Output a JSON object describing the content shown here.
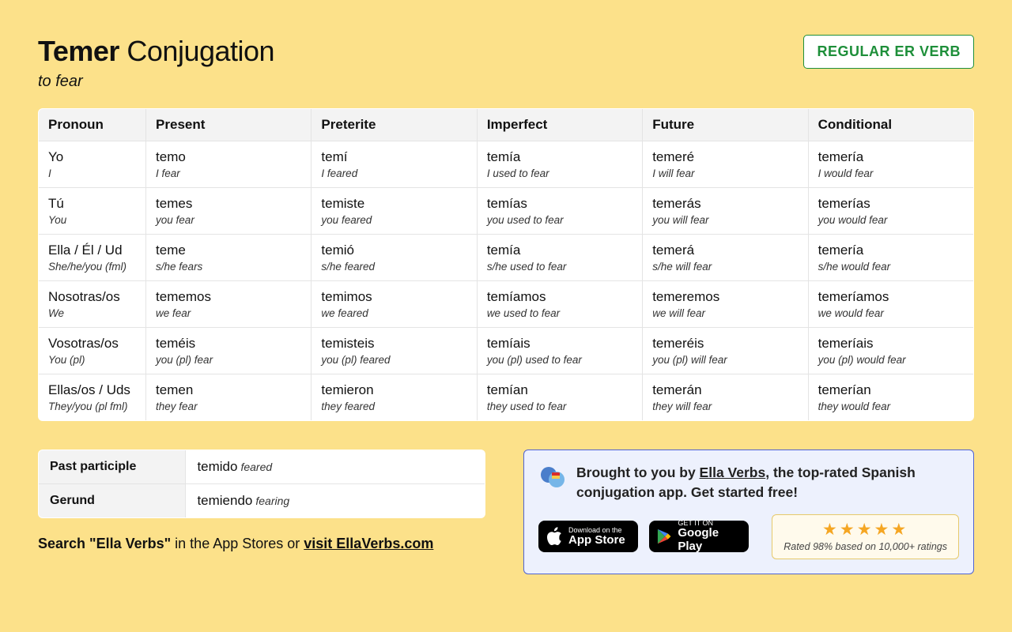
{
  "title_bold": "Temer",
  "title_rest": "Conjugation",
  "subtitle": "to fear",
  "badge": "REGULAR ER VERB",
  "headers": [
    "Pronoun",
    "Present",
    "Preterite",
    "Imperfect",
    "Future",
    "Conditional"
  ],
  "pronouns": [
    {
      "es": "Yo",
      "en": "I"
    },
    {
      "es": "Tú",
      "en": "You"
    },
    {
      "es": "Ella / Él / Ud",
      "en": "She/he/you (fml)"
    },
    {
      "es": "Nosotras/os",
      "en": "We"
    },
    {
      "es": "Vosotras/os",
      "en": "You (pl)"
    },
    {
      "es": "Ellas/os / Uds",
      "en": "They/you (pl fml)"
    }
  ],
  "table": [
    [
      {
        "es": "temo",
        "en": "I fear"
      },
      {
        "es": "temí",
        "en": "I feared"
      },
      {
        "es": "temía",
        "en": "I used to fear"
      },
      {
        "es": "temeré",
        "en": "I will fear"
      },
      {
        "es": "temería",
        "en": "I would fear"
      }
    ],
    [
      {
        "es": "temes",
        "en": "you fear"
      },
      {
        "es": "temiste",
        "en": "you feared"
      },
      {
        "es": "temías",
        "en": "you used to fear"
      },
      {
        "es": "temerás",
        "en": "you will fear"
      },
      {
        "es": "temerías",
        "en": "you would fear"
      }
    ],
    [
      {
        "es": "teme",
        "en": "s/he fears"
      },
      {
        "es": "temió",
        "en": "s/he feared"
      },
      {
        "es": "temía",
        "en": "s/he used to fear"
      },
      {
        "es": "temerá",
        "en": "s/he will fear"
      },
      {
        "es": "temería",
        "en": "s/he would fear"
      }
    ],
    [
      {
        "es": "tememos",
        "en": "we fear"
      },
      {
        "es": "temimos",
        "en": "we feared"
      },
      {
        "es": "temíamos",
        "en": "we used to fear"
      },
      {
        "es": "temeremos",
        "en": "we will fear"
      },
      {
        "es": "temeríamos",
        "en": "we would fear"
      }
    ],
    [
      {
        "es": "teméis",
        "en": "you (pl) fear"
      },
      {
        "es": "temisteis",
        "en": "you (pl) feared"
      },
      {
        "es": "temíais",
        "en": "you (pl) used to fear"
      },
      {
        "es": "temeréis",
        "en": "you (pl) will fear"
      },
      {
        "es": "temeríais",
        "en": "you (pl) would fear"
      }
    ],
    [
      {
        "es": "temen",
        "en": "they fear"
      },
      {
        "es": "temieron",
        "en": "they feared"
      },
      {
        "es": "temían",
        "en": "they used to fear"
      },
      {
        "es": "temerán",
        "en": "they will fear"
      },
      {
        "es": "temerían",
        "en": "they would fear"
      }
    ]
  ],
  "forms": {
    "past_participle_label": "Past participle",
    "past_participle_es": "temido",
    "past_participle_en": "feared",
    "gerund_label": "Gerund",
    "gerund_es": "temiendo",
    "gerund_en": "fearing"
  },
  "search_line_bold": "Search \"Ella Verbs\"",
  "search_line_mid": " in the App Stores or ",
  "search_line_link": "visit EllaVerbs.com",
  "promo": {
    "pre": "Brought to you by ",
    "link": "Ella Verbs",
    "post": ", the top-rated Spanish conjugation app. Get started free!",
    "appstore_small": "Download on the",
    "appstore_big": "App Store",
    "gplay_small": "GET IT ON",
    "gplay_big": "Google Play",
    "stars": "★★★★★",
    "rating_text": "Rated 98% based on 10,000+ ratings"
  }
}
